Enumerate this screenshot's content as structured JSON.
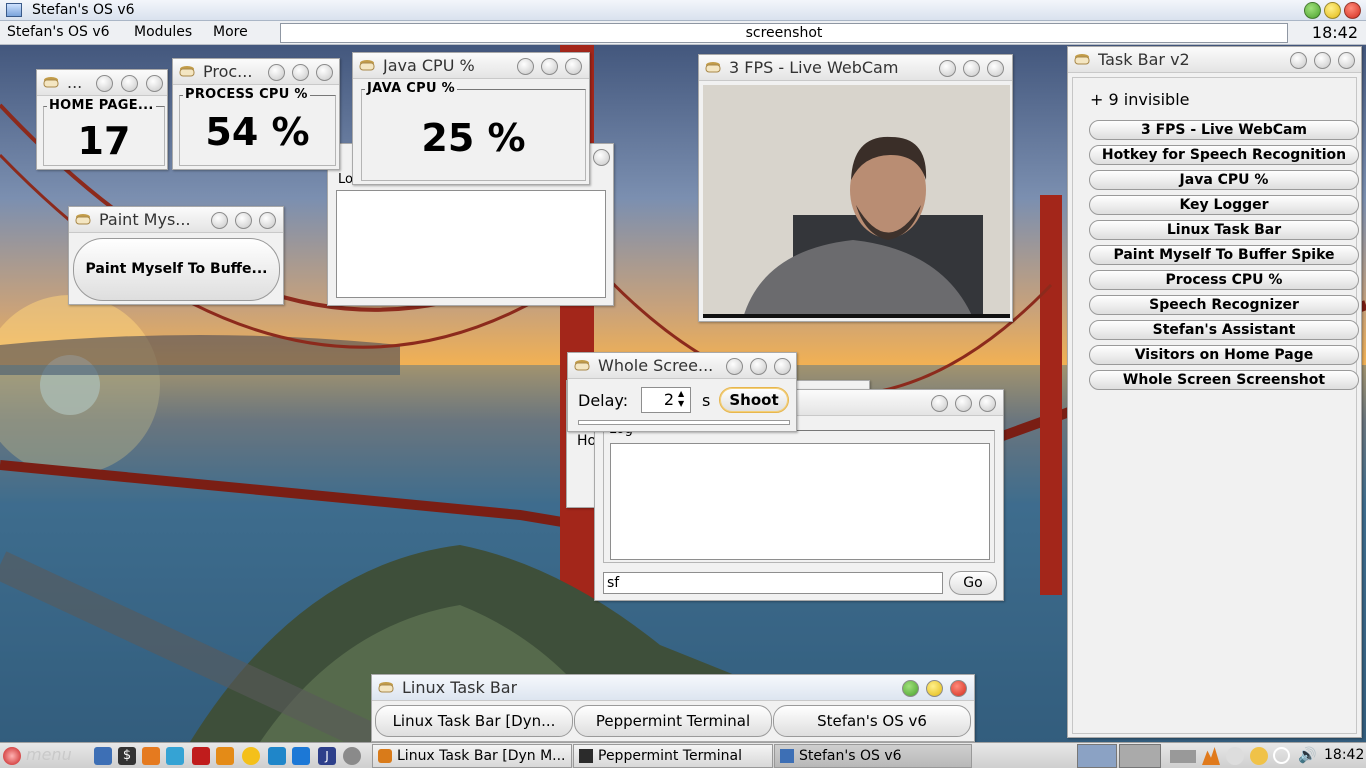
{
  "os_window": {
    "title": "Stefan's OS v6"
  },
  "menubar": {
    "items": [
      "Stefan's OS v6",
      "Modules",
      "More"
    ],
    "search_value": "screenshot",
    "clock": "18:42"
  },
  "windows": {
    "home_page": {
      "title": "...",
      "group_label": "HOME PAGE...",
      "value": "17"
    },
    "process_cpu": {
      "title": "Proc...",
      "group_label": "PROCESS CPU %",
      "value": "54 %"
    },
    "java_cpu": {
      "title": "Java CPU %",
      "group_label": "JAVA CPU %",
      "value": "25 %"
    },
    "hidden_log": {
      "label": "Lo"
    },
    "paint_myself": {
      "title": "Paint Mys...",
      "button": "Paint Myself To Buffe..."
    },
    "webcam": {
      "title": "3 FPS - Live WebCam"
    },
    "screenshot": {
      "title": "Whole Scree...",
      "delay_label": "Delay:",
      "delay_value": "2",
      "unit": "s",
      "shoot_label": "Shoot"
    },
    "speech_log": {
      "under_label": "Ho",
      "group_label": "Log",
      "input_value": "sf",
      "go_label": "Go"
    },
    "taskbar_v2": {
      "title": "Task Bar v2",
      "invisible_label": "+ 9 invisible",
      "items": [
        "3 FPS - Live WebCam",
        "Hotkey for Speech Recognition",
        "Java CPU %",
        "Key Logger",
        "Linux Task Bar",
        "Paint Myself To Buffer Spike",
        "Process CPU %",
        "Speech Recognizer",
        "Stefan's Assistant",
        "Visitors on Home Page",
        "Whole Screen Screenshot"
      ]
    },
    "linux_taskbar": {
      "title": "Linux Task Bar",
      "buttons": [
        "Linux Task Bar [Dyn...",
        "Peppermint Terminal",
        "Stefan's OS v6"
      ]
    }
  },
  "panel": {
    "menu_label": "menu",
    "tasks": [
      "Linux Task Bar [Dyn M...",
      "Peppermint Terminal",
      "Stefan's OS v6"
    ],
    "clock": "18:42"
  },
  "colors": {
    "close": "#e83b2f",
    "minimize": "#f3d12a",
    "maximize": "#5dbb3b"
  }
}
